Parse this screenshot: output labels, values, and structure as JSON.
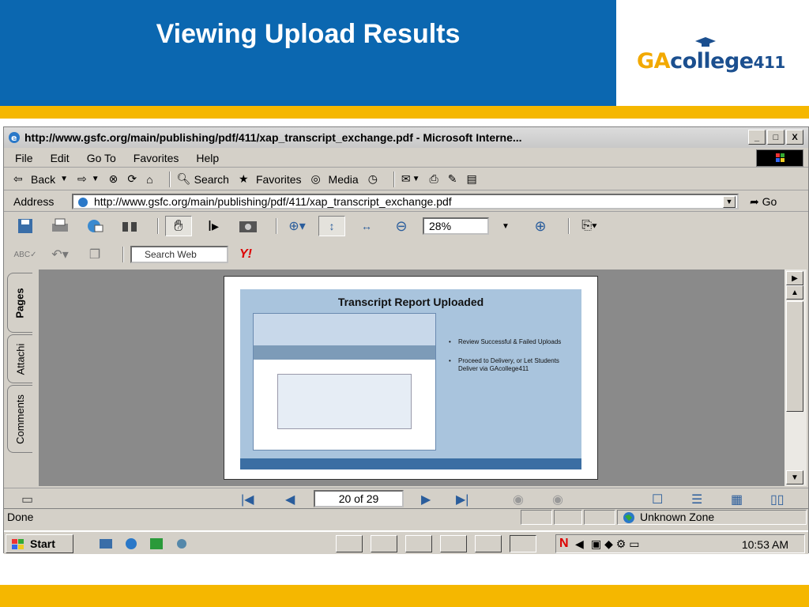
{
  "slide": {
    "title": "Viewing Upload Results",
    "logo": {
      "ga": "GA",
      "college": "college",
      "num": "411"
    }
  },
  "browser": {
    "window_title": "http://www.gsfc.org/main/publishing/pdf/411/xap_transcript_exchange.pdf - Microsoft Interne...",
    "window_buttons": {
      "minimize": "_",
      "maximize": "□",
      "close": "X"
    },
    "menu": [
      "File",
      "Edit",
      "Go To",
      "Favorites",
      "Help"
    ],
    "toolbar": {
      "back": "Back",
      "search": "Search",
      "favorites": "Favorites",
      "media": "Media"
    },
    "address": {
      "label": "Address",
      "url": "http://www.gsfc.org/main/publishing/pdf/411/xap_transcript_exchange.pdf",
      "go": "Go"
    },
    "acrobat": {
      "zoom": "28%",
      "search_placeholder": "Search Web",
      "yahoo": "Y!"
    },
    "side_tabs": [
      "Pages",
      "Attachi",
      "Comments"
    ],
    "page_content": {
      "title": "Transcript Report Uploaded",
      "bullets": [
        "Review Successful & Failed Uploads",
        "Proceed to Delivery, or Let Students Deliver via GAcollege411"
      ]
    },
    "navigation": {
      "page_indicator": "20 of 29"
    },
    "status": {
      "text": "Done",
      "zone": "Unknown Zone"
    }
  },
  "taskbar": {
    "start": "Start",
    "clock": "10:53 AM"
  },
  "colors": {
    "header_blue": "#0b67b0",
    "accent_yellow": "#f5b700",
    "win_gray": "#d4d0c8"
  }
}
